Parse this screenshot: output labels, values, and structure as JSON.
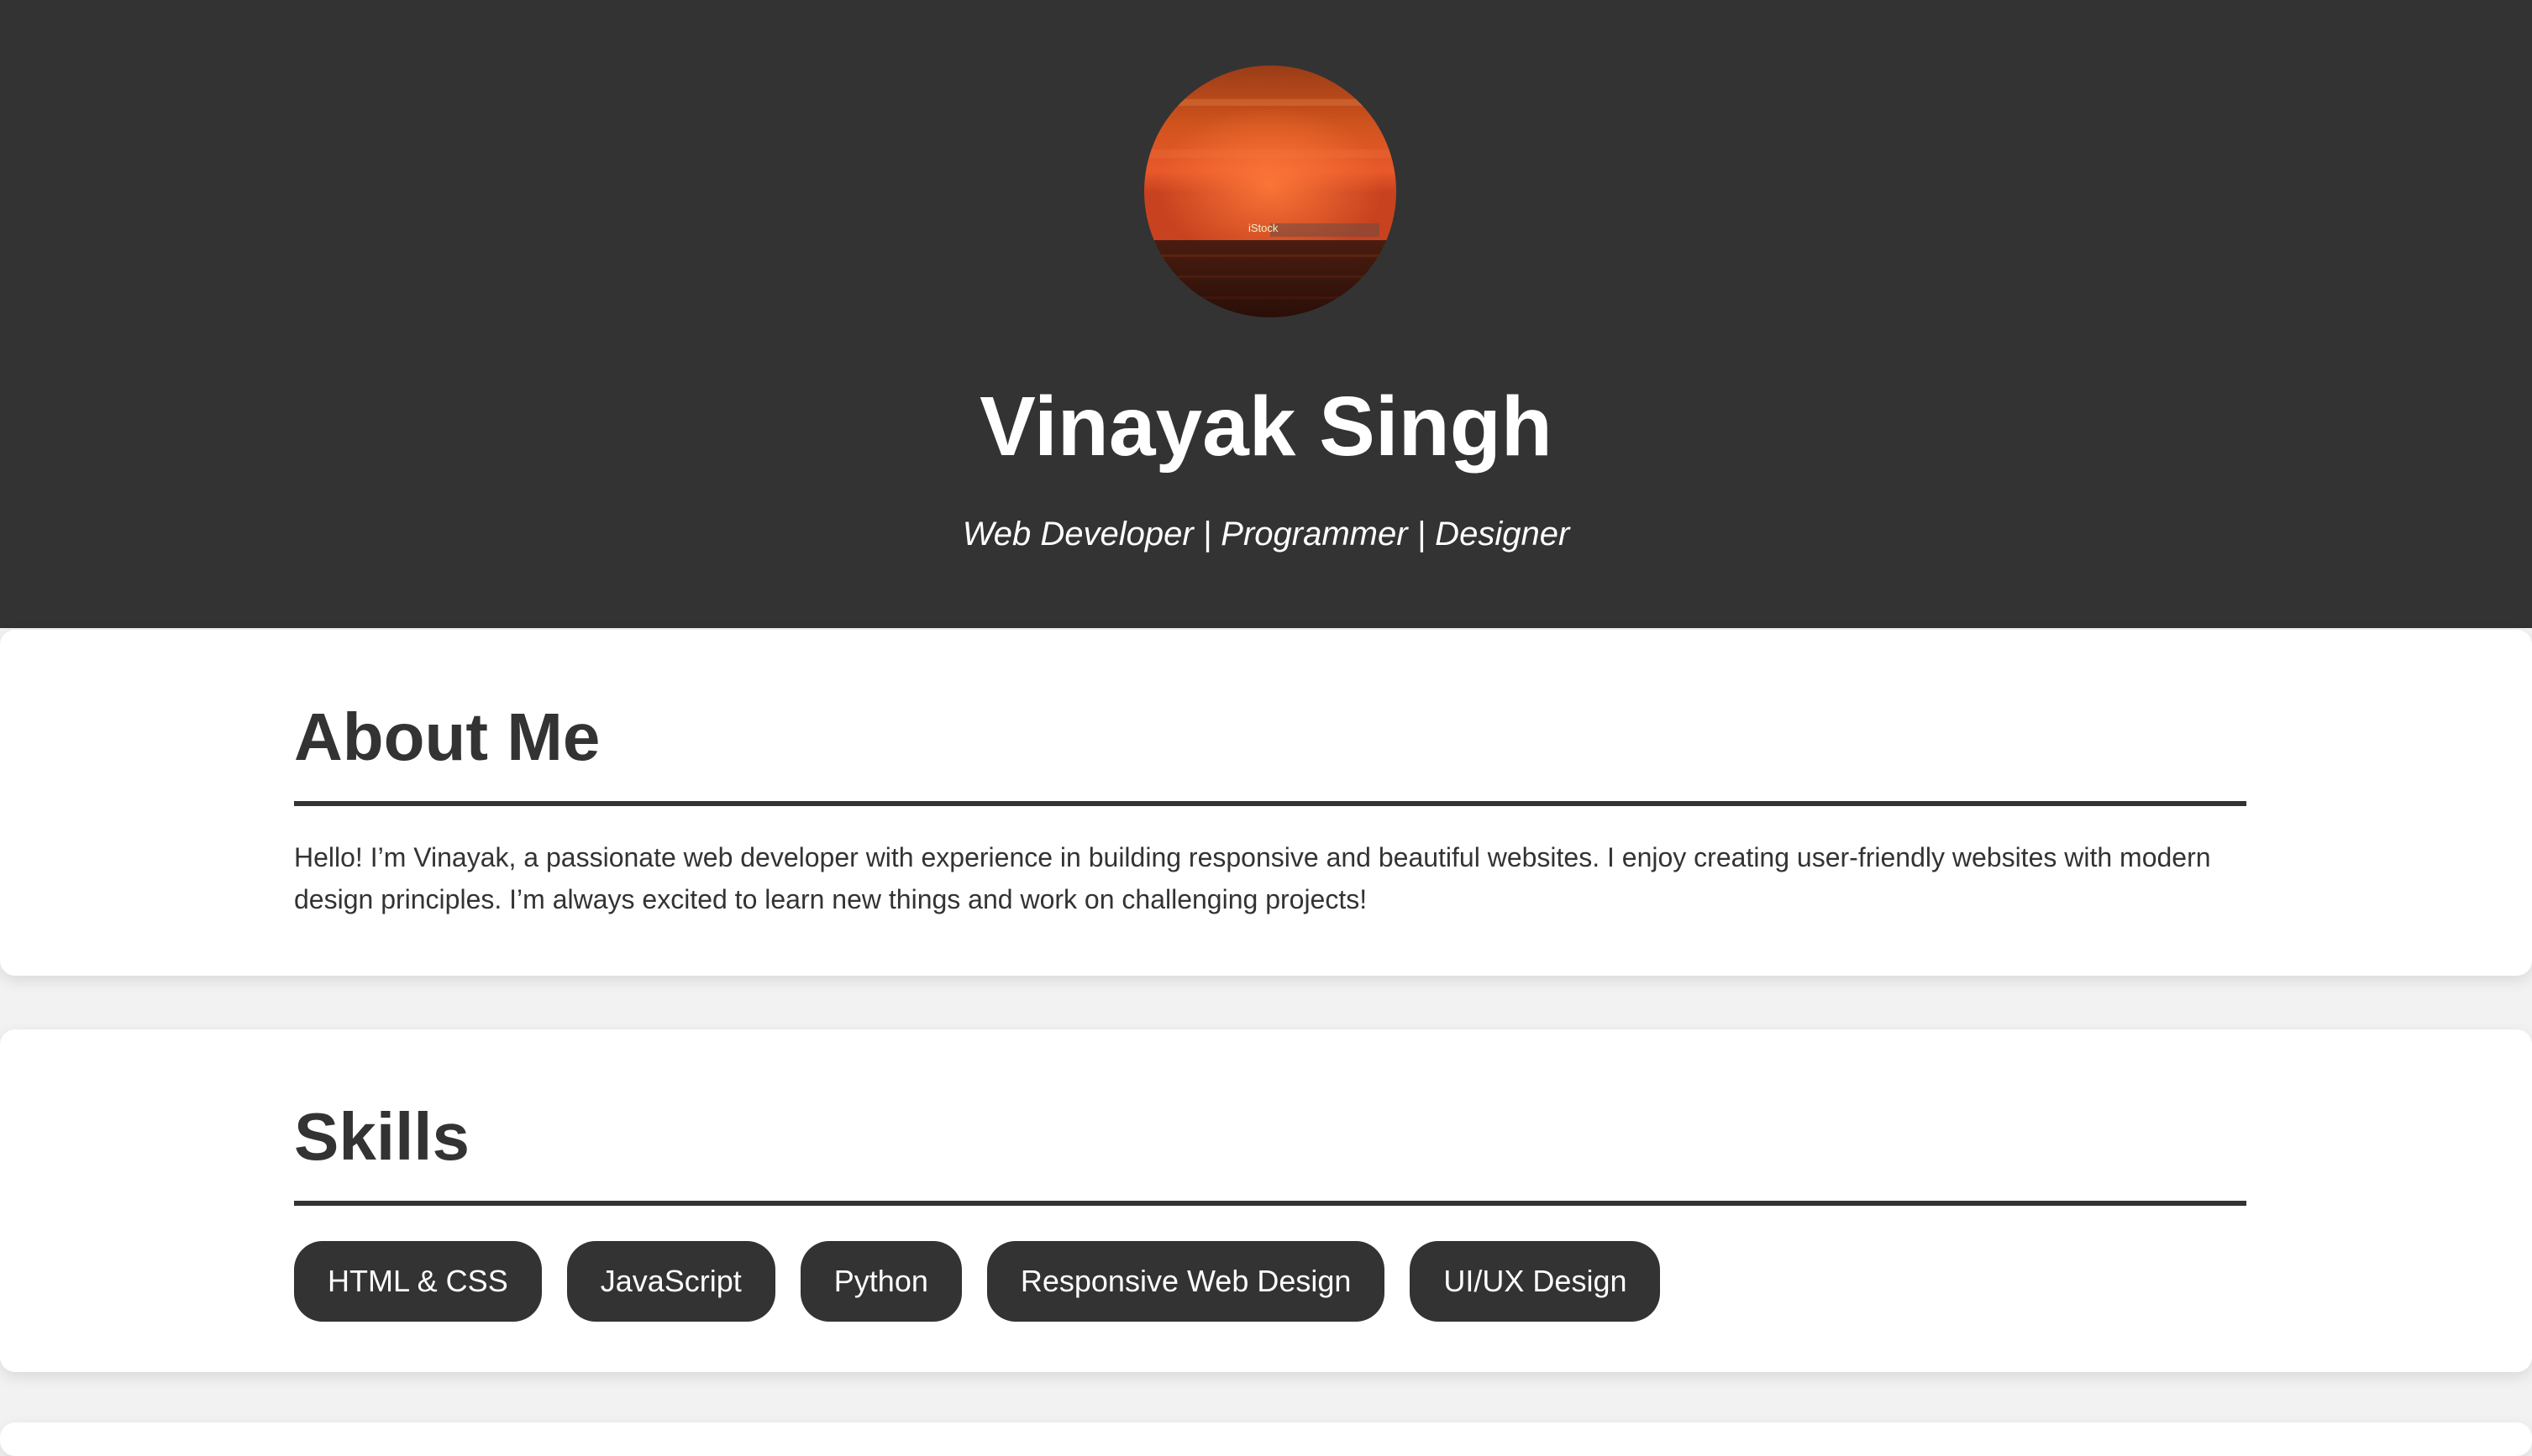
{
  "header": {
    "name": "Vinayak Singh",
    "tagline": "Web Developer | Programmer | Designer",
    "avatar_icon": "sunset-over-sea-photo",
    "avatar_watermark": "iStock"
  },
  "about": {
    "title": "About Me",
    "text": "Hello! I’m Vinayak, a passionate web developer with experience in building responsive and beautiful websites. I enjoy creating user-friendly websites with modern design principles. I’m always excited to learn new things and work on challenging projects!"
  },
  "skills": {
    "title": "Skills",
    "items": [
      {
        "label": "HTML & CSS"
      },
      {
        "label": "JavaScript"
      },
      {
        "label": "Python"
      },
      {
        "label": "Responsive Web Design"
      },
      {
        "label": "UI/UX Design"
      }
    ]
  },
  "colors": {
    "header_bg": "#333333",
    "page_bg": "#f2f2f2",
    "card_bg": "#ffffff",
    "pill_bg": "#333333",
    "text": "#333333"
  }
}
